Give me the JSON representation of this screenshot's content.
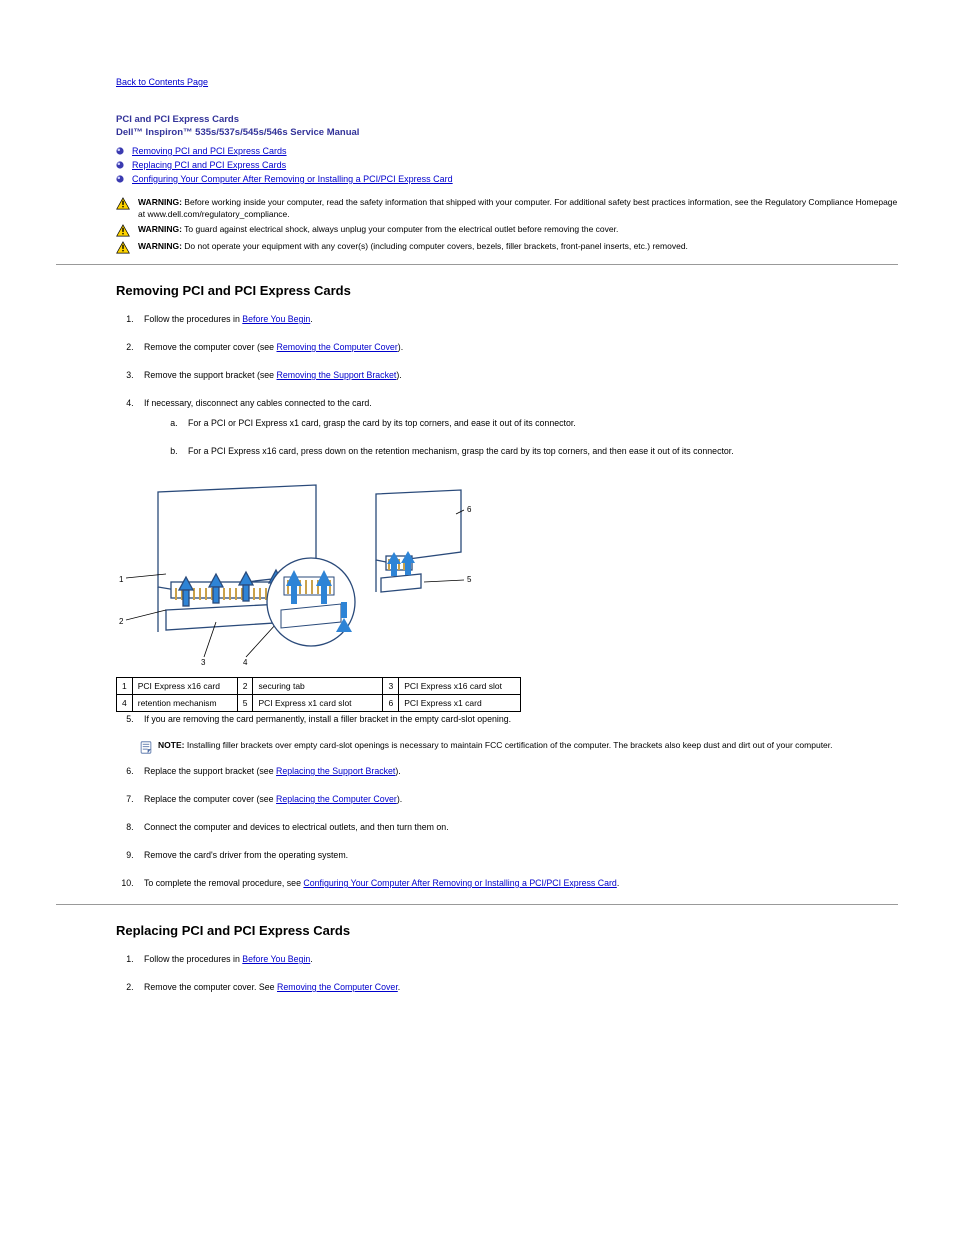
{
  "nav": {
    "back": "Back to Contents Page",
    "title_prefix": "PCI and PCI Express Cards",
    "manual": "Dell™ Inspiron™ 535s/537s/545s/546s Service Manual"
  },
  "toc": [
    {
      "label": "Removing PCI and PCI Express Cards"
    },
    {
      "label": "Replacing PCI and PCI Express Cards"
    },
    {
      "label": "Configuring Your Computer After Removing or Installing a PCI/PCI Express Card"
    }
  ],
  "warnings": [
    "Before working inside your computer, read the safety information that shipped with your computer. For additional safety best practices information, see the Regulatory Compliance Homepage at www.dell.com/regulatory_compliance.",
    "To guard against electrical shock, always unplug your computer from the electrical outlet before removing the cover.",
    "Do not operate your equipment with any cover(s) (including computer covers, bezels, filler brackets, front-panel inserts, etc.) removed."
  ],
  "warning_label": "WARNING:",
  "sections": {
    "remove": {
      "heading": "Removing PCI and PCI Express Cards",
      "steps": [
        {
          "pre": "Follow the procedures in ",
          "link": "Before You Begin",
          "post": "."
        },
        {
          "pre": "Remove the computer cover (see ",
          "link": "Removing the Computer Cover",
          "post": ")."
        },
        {
          "pre": "Remove the support bracket (see ",
          "link": "Removing the Support Bracket",
          "post": ")."
        },
        {
          "text": "If necessary, disconnect any cables connected to the card."
        },
        {
          "sub": [
            "For a PCI or PCI Express x1 card, grasp the card by its top corners, and ease it out of its connector.",
            "For a PCI Express x16 card, press down on the retention mechanism, grasp the card by its top corners, and then ease it out of its connector."
          ]
        }
      ],
      "table": [
        [
          "1",
          "PCI Express x16 card",
          "2",
          "securing tab",
          "3",
          "PCI Express x16 card slot"
        ],
        [
          "4",
          "retention mechanism",
          "5",
          "PCI Express x1 card slot",
          "6",
          "PCI Express x1 card"
        ]
      ],
      "post_steps": [
        {
          "text": "If you are removing the card permanently, install a filler bracket in the empty card-slot opening."
        },
        {
          "pre": "Replace the support bracket (see ",
          "link": "Replacing the Support Bracket",
          "post": ")."
        },
        {
          "pre": "Replace the computer cover (see ",
          "link": "Replacing the Computer Cover",
          "post": ")."
        },
        {
          "text": "Connect the computer and devices to electrical outlets, and then turn them on."
        },
        {
          "text": "Remove the card's driver from the operating system."
        },
        {
          "pre": "To complete the removal procedure, see ",
          "link": "Configuring Your Computer After Removing or Installing a PCI/PCI Express Card",
          "post": "."
        }
      ],
      "note": {
        "label": "NOTE:",
        "text": "Installing filler brackets over empty card-slot openings is necessary to maintain FCC certification of the computer. The brackets also keep dust and dirt out of your computer."
      }
    },
    "replace": {
      "heading": "Replacing PCI and PCI Express Cards",
      "steps": [
        {
          "pre": "Follow the procedures in ",
          "link": "Before You Begin",
          "post": "."
        },
        {
          "pre": "Remove the computer cover. See ",
          "link": "Removing the Computer Cover",
          "post": "."
        }
      ]
    }
  }
}
